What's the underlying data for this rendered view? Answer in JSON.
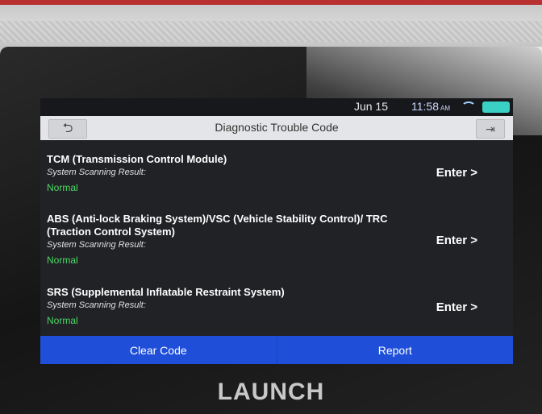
{
  "status_bar": {
    "date": "Jun 15",
    "time": "11:58",
    "ampm": "AM"
  },
  "header": {
    "title": "Diagnostic Trouble Code"
  },
  "systems": [
    {
      "name": "TCM (Transmission Control Module)",
      "scan_label": "System Scanning Result:",
      "status": "Normal",
      "enter_label": "Enter >"
    },
    {
      "name": "ABS (Anti-lock Braking System)/VSC (Vehicle Stability Control)/ TRC (Traction Control System)",
      "scan_label": "System Scanning Result:",
      "status": "Normal",
      "enter_label": "Enter >"
    },
    {
      "name": "SRS (Supplemental Inflatable Restraint System)",
      "scan_label": "System Scanning Result:",
      "status": "Normal",
      "enter_label": "Enter >"
    }
  ],
  "actions": {
    "clear_label": "Clear Code",
    "report_label": "Report"
  },
  "device": {
    "brand": "LAUNCH"
  },
  "colors": {
    "action_blue": "#1f4fd8",
    "status_green": "#4cd964"
  }
}
